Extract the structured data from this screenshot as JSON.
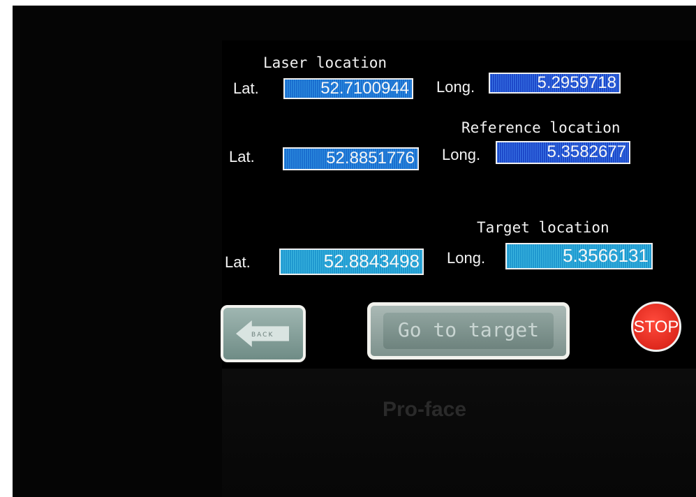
{
  "device": {
    "brand": "Pro-face"
  },
  "laser": {
    "title": "Laser location",
    "lat_label": "Lat.",
    "lat_value": "52.7100944",
    "long_label": "Long.",
    "long_value": "5.2959718"
  },
  "reference": {
    "title": "Reference location",
    "lat_label": "Lat.",
    "lat_value": "52.8851776",
    "long_label": "Long.",
    "long_value": "5.3582677"
  },
  "target": {
    "title": "Target location",
    "lat_label": "Lat.",
    "lat_value": "52.8843498",
    "long_label": "Long.",
    "long_value": "5.3566131"
  },
  "buttons": {
    "back_label": "BACK",
    "go_label": "Go to target",
    "stop_label": "STOP"
  },
  "colors": {
    "field_blue": "#1a6ecf",
    "field_cyan": "#1f98cf",
    "stop_red": "#d11a10"
  }
}
